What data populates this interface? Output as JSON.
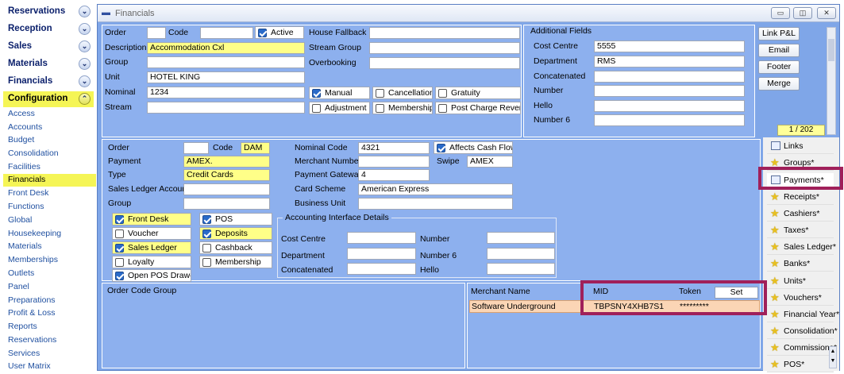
{
  "nav": {
    "sections": [
      "Reservations",
      "Reception",
      "Sales",
      "Materials",
      "Financials",
      "Configuration"
    ],
    "items": [
      "Access",
      "Accounts",
      "Budget",
      "Consolidation",
      "Facilities",
      "Financials",
      "Front Desk",
      "Functions",
      "Global",
      "Housekeeping",
      "Materials",
      "Memberships",
      "Outlets",
      "Panel",
      "Preparations",
      "Profit & Loss",
      "Reports",
      "Reservations",
      "Services",
      "User Matrix"
    ]
  },
  "window": {
    "title": "Financials"
  },
  "top": {
    "order_label": "Order",
    "order_value": "",
    "code_label": "Code",
    "code_value": "",
    "active_label": "Active",
    "description_label": "Description",
    "description_value": "Accommodation Cxl",
    "group_label": "Group",
    "group_value": "",
    "unit_label": "Unit",
    "unit_value": "HOTEL KING",
    "nominal_label": "Nominal",
    "nominal_value": "1234",
    "stream_label": "Stream",
    "stream_value": "",
    "house_fallback_label": "House Fallback",
    "house_fallback_value": "",
    "stream_group_label": "Stream Group",
    "stream_group_value": "",
    "overbooking_label": "Overbooking",
    "overbooking_value": "",
    "manual_label": "Manual",
    "cancellation_label": "Cancellation",
    "gratuity_label": "Gratuity",
    "adjustment_label": "Adjustment",
    "membership_label": "Membership",
    "post_charge_label": "Post Charge Revenue"
  },
  "additional": {
    "title": "Additional Fields",
    "cost_centre_label": "Cost Centre",
    "cost_centre_value": "5555",
    "department_label": "Department",
    "department_value": "RMS",
    "concatenated_label": "Concatenated",
    "concatenated_value": "",
    "number_label": "Number",
    "number_value": "",
    "hello_label": "Hello",
    "hello_value": "",
    "number6_label": "Number 6",
    "number6_value": ""
  },
  "buttons": {
    "link_pl": "Link P&L",
    "email": "Email",
    "footer": "Footer",
    "merge": "Merge"
  },
  "record_counter": "1 / 202",
  "payment": {
    "order_label": "Order",
    "order_value": "",
    "code_label": "Code",
    "code_value": "DAM",
    "payment_label": "Payment",
    "payment_value": "AMEX.",
    "type_label": "Type",
    "type_value": "Credit Cards",
    "sales_ledger_account_label": "Sales Ledger Account",
    "sales_ledger_account_value": "",
    "group_label": "Group",
    "group_value": "",
    "nominal_code_label": "Nominal Code",
    "nominal_code_value": "4321",
    "affects_cash_flow_label": "Affects Cash Flow",
    "merchant_number_label": "Merchant Number",
    "merchant_number_value": "",
    "swipe_label": "Swipe",
    "swipe_value": "AMEX",
    "payment_gateway_label": "Payment Gateway",
    "payment_gateway_value": "4",
    "card_scheme_label": "Card Scheme",
    "card_scheme_value": "American Express",
    "business_unit_label": "Business Unit",
    "business_unit_value": "",
    "front_desk_label": "Front Desk",
    "pos_label": "POS",
    "voucher_label": "Voucher",
    "deposits_label": "Deposits",
    "sales_ledger_label": "Sales Ledger",
    "cashback_label": "Cashback",
    "loyalty_label": "Loyalty",
    "membership_label": "Membership",
    "open_pos_drawer_label": "Open POS Drawer"
  },
  "accounting": {
    "title": "Accounting Interface Details",
    "cost_centre_label": "Cost Centre",
    "number_label": "Number",
    "department_label": "Department",
    "number6_label": "Number 6",
    "concatenated_label": "Concatenated",
    "hello_label": "Hello",
    "cost_centre_value": "",
    "number_value": "",
    "department_value": "",
    "number6_value": "",
    "concatenated_value": "",
    "hello_value": ""
  },
  "grid_left": {
    "headers": [
      "Order",
      "Code",
      "Group"
    ]
  },
  "merchant_grid": {
    "headers": {
      "merchant_name": "Merchant Name",
      "mid": "MID",
      "token": "Token"
    },
    "set_label": "Set",
    "row": {
      "merchant_name": "Software Underground",
      "mid": "TBPSNY4XHB7S1",
      "token": "*********"
    }
  },
  "tabs": [
    "Links",
    "Groups*",
    "Payments*",
    "Receipts*",
    "Cashiers*",
    "Taxes*",
    "Sales Ledger*",
    "Banks*",
    "Units*",
    "Vouchers*",
    "Financial Year*",
    "Consolidation*",
    "Commissions*",
    "POS*"
  ],
  "colors": {
    "highlight": "#a0205a",
    "field_yellow": "#ffff88",
    "panel_blue": "#8db0ee",
    "nav_selected": "#f5f556"
  }
}
